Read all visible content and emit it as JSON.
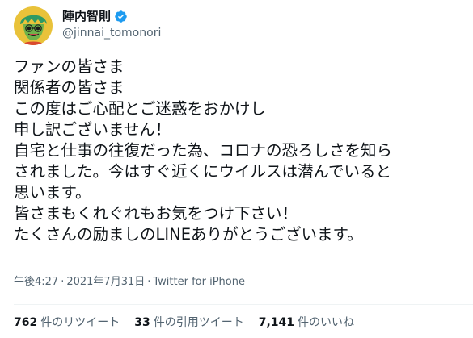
{
  "account": {
    "display_name": "陣内智則",
    "handle": "@jinnai_tomonori",
    "verified_icon": "verified-badge-icon",
    "verified_color": "#1d9bf0"
  },
  "tweet": {
    "lines": [
      "ファンの皆さま",
      "関係者の皆さま",
      "この度はご心配とご迷惑をおかけし",
      "申し訳ございません！",
      "自宅と仕事の往復だった為、コロナの恐ろしさを知ら",
      "されました。今はすぐ近くにウイルスは潜んでいると",
      "思います。",
      "皆さまもくれぐれもお気をつけ下さい！",
      "たくさんの励ましのLINEありがとうございます。"
    ],
    "time": "午後4:27",
    "date": "2021年7月31日",
    "source": "Twitter for iPhone"
  },
  "stats": {
    "retweets_count": "762",
    "retweets_label": "件のリツイート",
    "quotes_count": "33",
    "quotes_label": "件の引用ツイート",
    "likes_count": "7,141",
    "likes_label": "件のいいね"
  }
}
